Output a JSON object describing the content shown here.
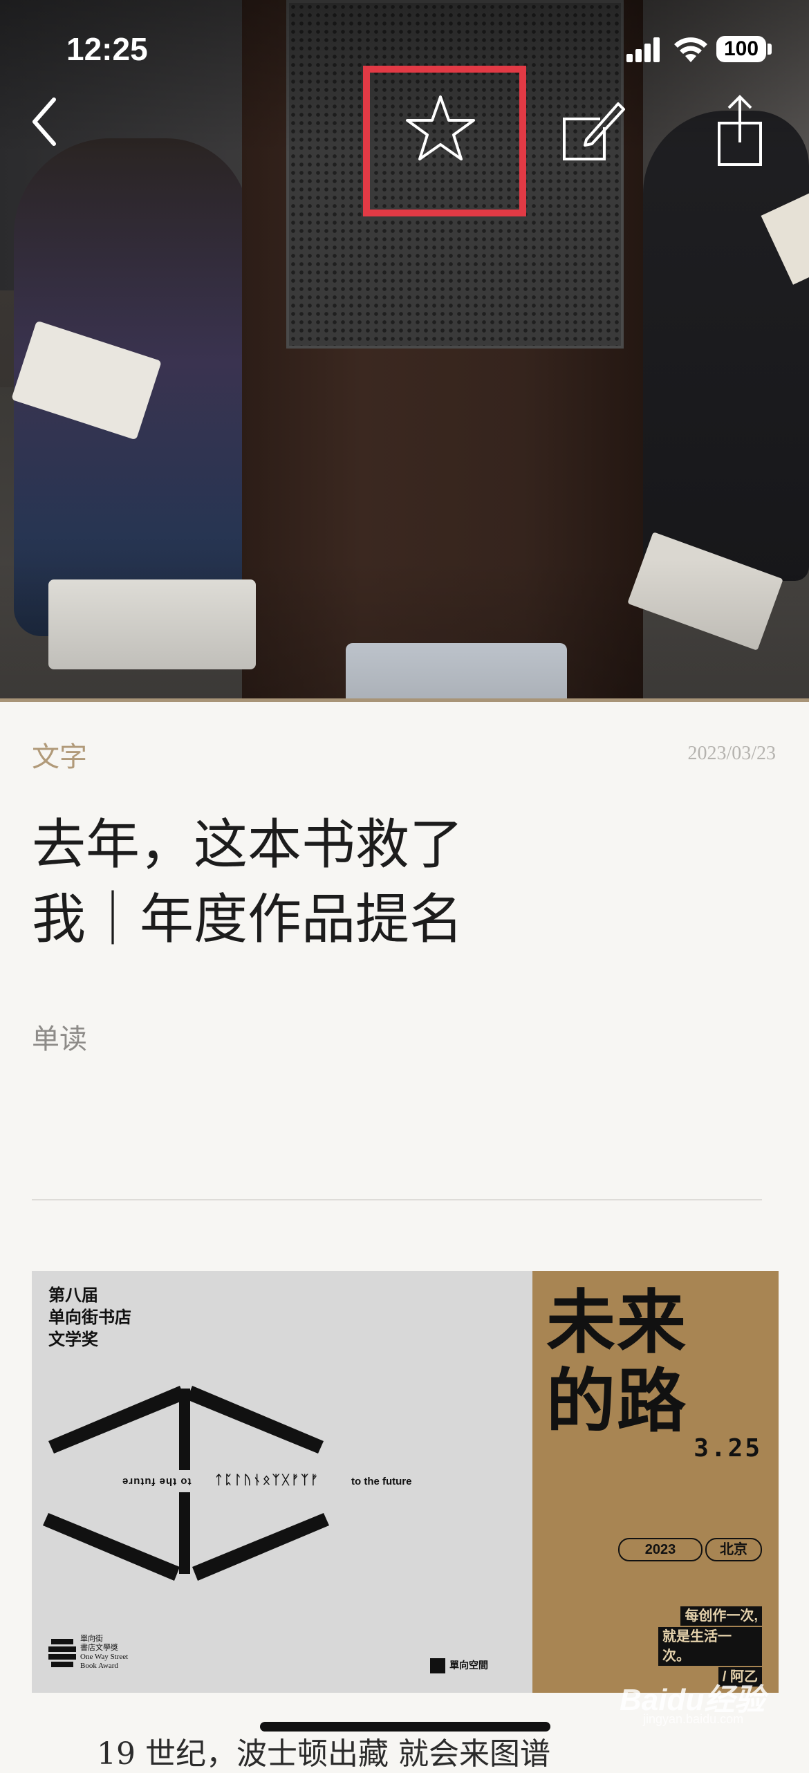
{
  "status_bar": {
    "time": "12:25",
    "battery": "100"
  },
  "nav": {
    "back": "back-icon",
    "favorite": "star-icon",
    "comment": "edit-icon",
    "share": "share-icon",
    "highlight_color": "#e23a45"
  },
  "article": {
    "category": "文字",
    "date": "2023/03/23",
    "title_line1": "去年，这本书救了",
    "title_line2": "我｜年度作品提名",
    "author": "单读"
  },
  "poster": {
    "award": "第八届\n单向街书店\n文学奖",
    "to_future_mirror": "to the future",
    "glyphs": "ᛏᛈᛚᚢᚾᛟᛉᚷᚠᛉᚠ",
    "to_future": "to the future",
    "org_logo_text": "單向街\n書店文學獎\nOne Way Street\nBook Award",
    "space_logo": "單向空間",
    "big_title": "未来\n的路",
    "event_date": "3.25",
    "year": "2023",
    "city": "北京",
    "slogan_line1": "每创作一次,",
    "slogan_line2": "就是生活一次。",
    "slogan_line3": "/ 阿乙",
    "accent_color": "#a88553"
  },
  "next_paragraph": "19 世纪，波士顿出藏 就会来图谱",
  "watermark": {
    "brand": "Baidu经验",
    "url": "jingyan.baidu.com"
  }
}
